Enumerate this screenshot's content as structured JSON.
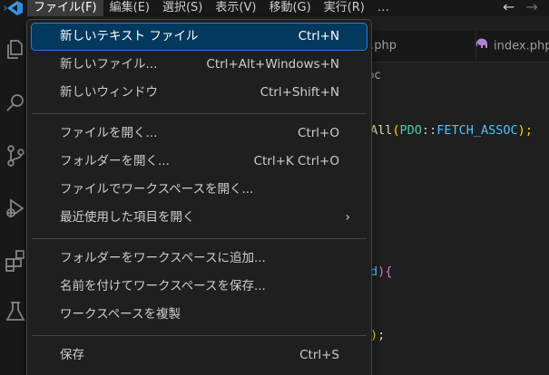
{
  "menubar": {
    "items": [
      "ファイル(F)",
      "編集(E)",
      "選択(S)",
      "表示(V)",
      "移動(G)",
      "実行(R)",
      "…"
    ],
    "active_index": 0,
    "back_arrow": "←",
    "forward_arrow": "→"
  },
  "activity_bar": {
    "icons": [
      "explorer-icon",
      "search-icon",
      "source-control-icon",
      "run-debug-icon",
      "extensions-icon",
      "testing-icon"
    ]
  },
  "tabs": [
    {
      "label": "reate.php",
      "icon": ""
    },
    {
      "label": "index.php",
      "icon": "php-elephant-icon"
    }
  ],
  "breadcrumb": "dbc",
  "code_lines": {
    "fetch_all": {
      "fn": "All",
      "open": "(",
      "cls": "PDO",
      "sep": "::",
      "const": "FETCH_ASSOC",
      "close": ");"
    },
    "brace_line": {
      "text": "d",
      "close": ")",
      "brace": "{"
    },
    "end_line": {
      "close": ")",
      "semi": ";"
    }
  },
  "file_menu": {
    "sections": [
      [
        {
          "label": "新しいテキスト ファイル",
          "shortcut": "Ctrl+N",
          "selected": true
        },
        {
          "label": "新しいファイル...",
          "shortcut": "Ctrl+Alt+Windows+N"
        },
        {
          "label": "新しいウィンドウ",
          "shortcut": "Ctrl+Shift+N"
        }
      ],
      [
        {
          "label": "ファイルを開く...",
          "shortcut": "Ctrl+O"
        },
        {
          "label": "フォルダーを開く...",
          "shortcut": "Ctrl+K Ctrl+O"
        },
        {
          "label": "ファイルでワークスペースを開く...",
          "shortcut": ""
        },
        {
          "label": "最近使用した項目を開く",
          "shortcut": "",
          "submenu": "›"
        }
      ],
      [
        {
          "label": "フォルダーをワークスペースに追加...",
          "shortcut": ""
        },
        {
          "label": "名前を付けてワークスペースを保存...",
          "shortcut": ""
        },
        {
          "label": "ワークスペースを複製",
          "shortcut": ""
        }
      ],
      [
        {
          "label": "保存",
          "shortcut": "Ctrl+S"
        }
      ]
    ]
  },
  "colors": {
    "menu_bg": "#1f1f1f",
    "selected_bg": "#04395e",
    "selected_border": "#2b79d8",
    "vscode_blue": "#3c9be8"
  }
}
